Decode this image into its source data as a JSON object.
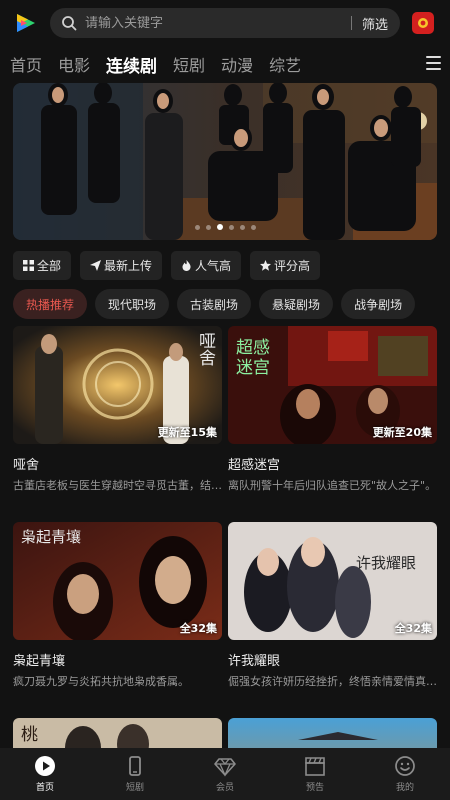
{
  "search": {
    "placeholder": "请输入关键字",
    "filter_label": "筛选"
  },
  "tabs": [
    {
      "label": "首页"
    },
    {
      "label": "电影"
    },
    {
      "label": "连续剧"
    },
    {
      "label": "短剧"
    },
    {
      "label": "动漫"
    },
    {
      "label": "综艺"
    }
  ],
  "active_tab": "连续剧",
  "banner": {
    "dot_count": 6,
    "active_dot": 3
  },
  "sorts": [
    {
      "label": "全部",
      "icon": "grid-icon"
    },
    {
      "label": "最新上传",
      "icon": "send-icon"
    },
    {
      "label": "人气高",
      "icon": "fire-icon"
    },
    {
      "label": "评分高",
      "icon": "star-icon"
    }
  ],
  "genres": [
    {
      "label": "热播推荐"
    },
    {
      "label": "现代职场"
    },
    {
      "label": "古装剧场"
    },
    {
      "label": "悬疑剧场"
    },
    {
      "label": "战争剧场"
    }
  ],
  "shows": [
    {
      "title": "哑舍",
      "episodes": "更新至15集",
      "desc": "古董店老板与医生穿越时空寻觅古董，结下…",
      "poster_text": "哑舍"
    },
    {
      "title": "超感迷宫",
      "episodes": "更新至20集",
      "desc": "离队刑警十年后归队追查已死\"故人之子\"。",
      "poster_text": "超感迷宫"
    },
    {
      "title": "枭起青壤",
      "episodes": "全32集",
      "desc": "疯刀聂九罗与炎拓共抗地枭成香属。",
      "poster_text": "枭起青壤"
    },
    {
      "title": "许我耀眼",
      "episodes": "全32集",
      "desc": "倔强女孩许妍历经挫折，终悟亲情爱情真谛。",
      "poster_text": "许我耀眼"
    },
    {
      "title": "",
      "episodes": "",
      "desc": "",
      "poster_text": "桃"
    },
    {
      "title": "",
      "episodes": "",
      "desc": "",
      "poster_text": ""
    }
  ],
  "nav": [
    {
      "label": "首页",
      "icon": "play-circle-icon"
    },
    {
      "label": "短剧",
      "icon": "phone-icon"
    },
    {
      "label": "会员",
      "icon": "diamond-icon"
    },
    {
      "label": "预告",
      "icon": "clapper-icon"
    },
    {
      "label": "我的",
      "icon": "smile-icon"
    }
  ],
  "colors": {
    "accent": "#e9584f",
    "badge": "#d4201f",
    "background": "#121212"
  }
}
